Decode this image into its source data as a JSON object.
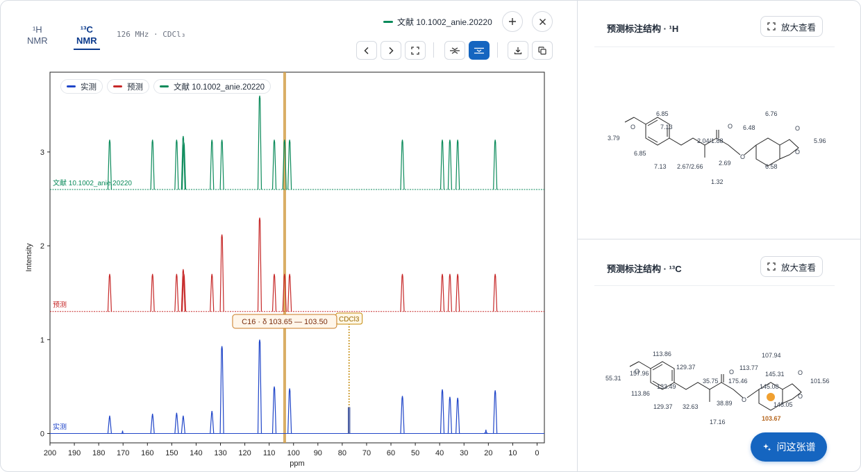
{
  "tabs": [
    {
      "sup": "¹H",
      "label": "NMR",
      "active": false
    },
    {
      "sup": "¹³C",
      "label": "NMR",
      "active": true
    }
  ],
  "meta": "126 MHz · CDCl₃",
  "reference_legend": "文献 10.1002_anie.20220",
  "toolbar_icons": [
    "add-icon",
    "close-icon",
    "chevron-left-icon",
    "chevron-right-icon",
    "fullscreen-icon",
    "stack-off-icon",
    "stack-on-icon",
    "download-icon",
    "copy-icon"
  ],
  "colors": {
    "measured": "#1f45c8",
    "predicted": "#c62828",
    "reference": "#0a8a5a",
    "accent": "#1565c0",
    "highlight": "#d4a04a",
    "cdcl3": "#c48a0a"
  },
  "chart_data": {
    "type": "line",
    "xlabel": "ppm",
    "ylabel": "Intensity",
    "xlim": [
      200,
      -3
    ],
    "ylim": [
      -0.1,
      3.85
    ],
    "x_ticks": [
      200,
      190,
      180,
      170,
      160,
      150,
      140,
      130,
      120,
      110,
      100,
      90,
      80,
      70,
      60,
      50,
      40,
      30,
      20,
      10,
      0
    ],
    "y_ticks": [
      0,
      1,
      2,
      3
    ],
    "legend": [
      "实测",
      "预测",
      "文献 10.1002_anie.20220"
    ],
    "series": [
      {
        "name": "实测",
        "baseline": 0,
        "peaks": [
          [
            175.5,
            0.19
          ],
          [
            170.2,
            0.03
          ],
          [
            157.9,
            0.21
          ],
          [
            148.0,
            0.22
          ],
          [
            145.3,
            0.19
          ],
          [
            133.5,
            0.24
          ],
          [
            129.4,
            0.93
          ],
          [
            113.9,
            1.0
          ],
          [
            107.9,
            0.5
          ],
          [
            101.6,
            0.48
          ],
          [
            55.3,
            0.4
          ],
          [
            38.9,
            0.47
          ],
          [
            35.8,
            0.39
          ],
          [
            32.6,
            0.38
          ],
          [
            21.0,
            0.04
          ],
          [
            17.2,
            0.46
          ]
        ],
        "solvent": {
          "x": 77.2,
          "y": 0.28
        }
      },
      {
        "name": "预测",
        "baseline": 1.3,
        "peaks": [
          [
            175.5,
            0.4
          ],
          [
            157.9,
            0.4
          ],
          [
            148.0,
            0.4
          ],
          [
            145.3,
            0.45
          ],
          [
            145.0,
            0.4
          ],
          [
            133.5,
            0.4
          ],
          [
            129.4,
            0.82
          ],
          [
            113.9,
            1.0
          ],
          [
            107.9,
            0.4
          ],
          [
            103.7,
            0.4
          ],
          [
            101.6,
            0.4
          ],
          [
            55.3,
            0.4
          ],
          [
            38.9,
            0.4
          ],
          [
            35.8,
            0.4
          ],
          [
            32.6,
            0.4
          ],
          [
            17.2,
            0.4
          ]
        ]
      },
      {
        "name": "文献 10.1002_anie.20220",
        "baseline": 2.6,
        "peaks": [
          [
            175.5,
            0.53
          ],
          [
            157.9,
            0.53
          ],
          [
            148.0,
            0.53
          ],
          [
            145.3,
            0.57
          ],
          [
            145.0,
            0.5
          ],
          [
            133.5,
            0.53
          ],
          [
            129.4,
            0.53
          ],
          [
            113.9,
            1.0
          ],
          [
            107.9,
            0.53
          ],
          [
            103.7,
            0.53
          ],
          [
            101.6,
            0.53
          ],
          [
            55.3,
            0.53
          ],
          [
            38.9,
            0.53
          ],
          [
            35.8,
            0.53
          ],
          [
            32.6,
            0.53
          ],
          [
            17.2,
            0.53
          ]
        ]
      }
    ],
    "series_labels": [
      "实测",
      "预测",
      "文献 10.1002_anie.20220"
    ],
    "highlight": {
      "x": 103.65,
      "label": "C16 · δ 103.65 — 103.50"
    },
    "solvent_label": "CDCl3",
    "solvent_x": 77.2
  },
  "panel_h": {
    "title": "预测标注结构 · ¹H",
    "zoom_label": "放大查看",
    "shifts": [
      "6.85",
      "7.13",
      "6.85",
      "7.13",
      "3.79",
      "2.04/1.88",
      "2.67/2.66",
      "2.69",
      "1.32",
      "6.48",
      "6.76",
      "5.96",
      "6.58"
    ]
  },
  "panel_c": {
    "title": "预测标注结构 · ¹³C",
    "zoom_label": "放大查看",
    "shifts": [
      "113.86",
      "129.37",
      "157.96",
      "55.31",
      "133.49",
      "113.86",
      "129.37",
      "32.63",
      "35.75",
      "38.89",
      "17.16",
      "175.46",
      "113.77",
      "107.94",
      "145.31",
      "145.08",
      "101.56",
      "148.05"
    ],
    "selected": "103.67"
  },
  "ask_label": "问这张谱"
}
